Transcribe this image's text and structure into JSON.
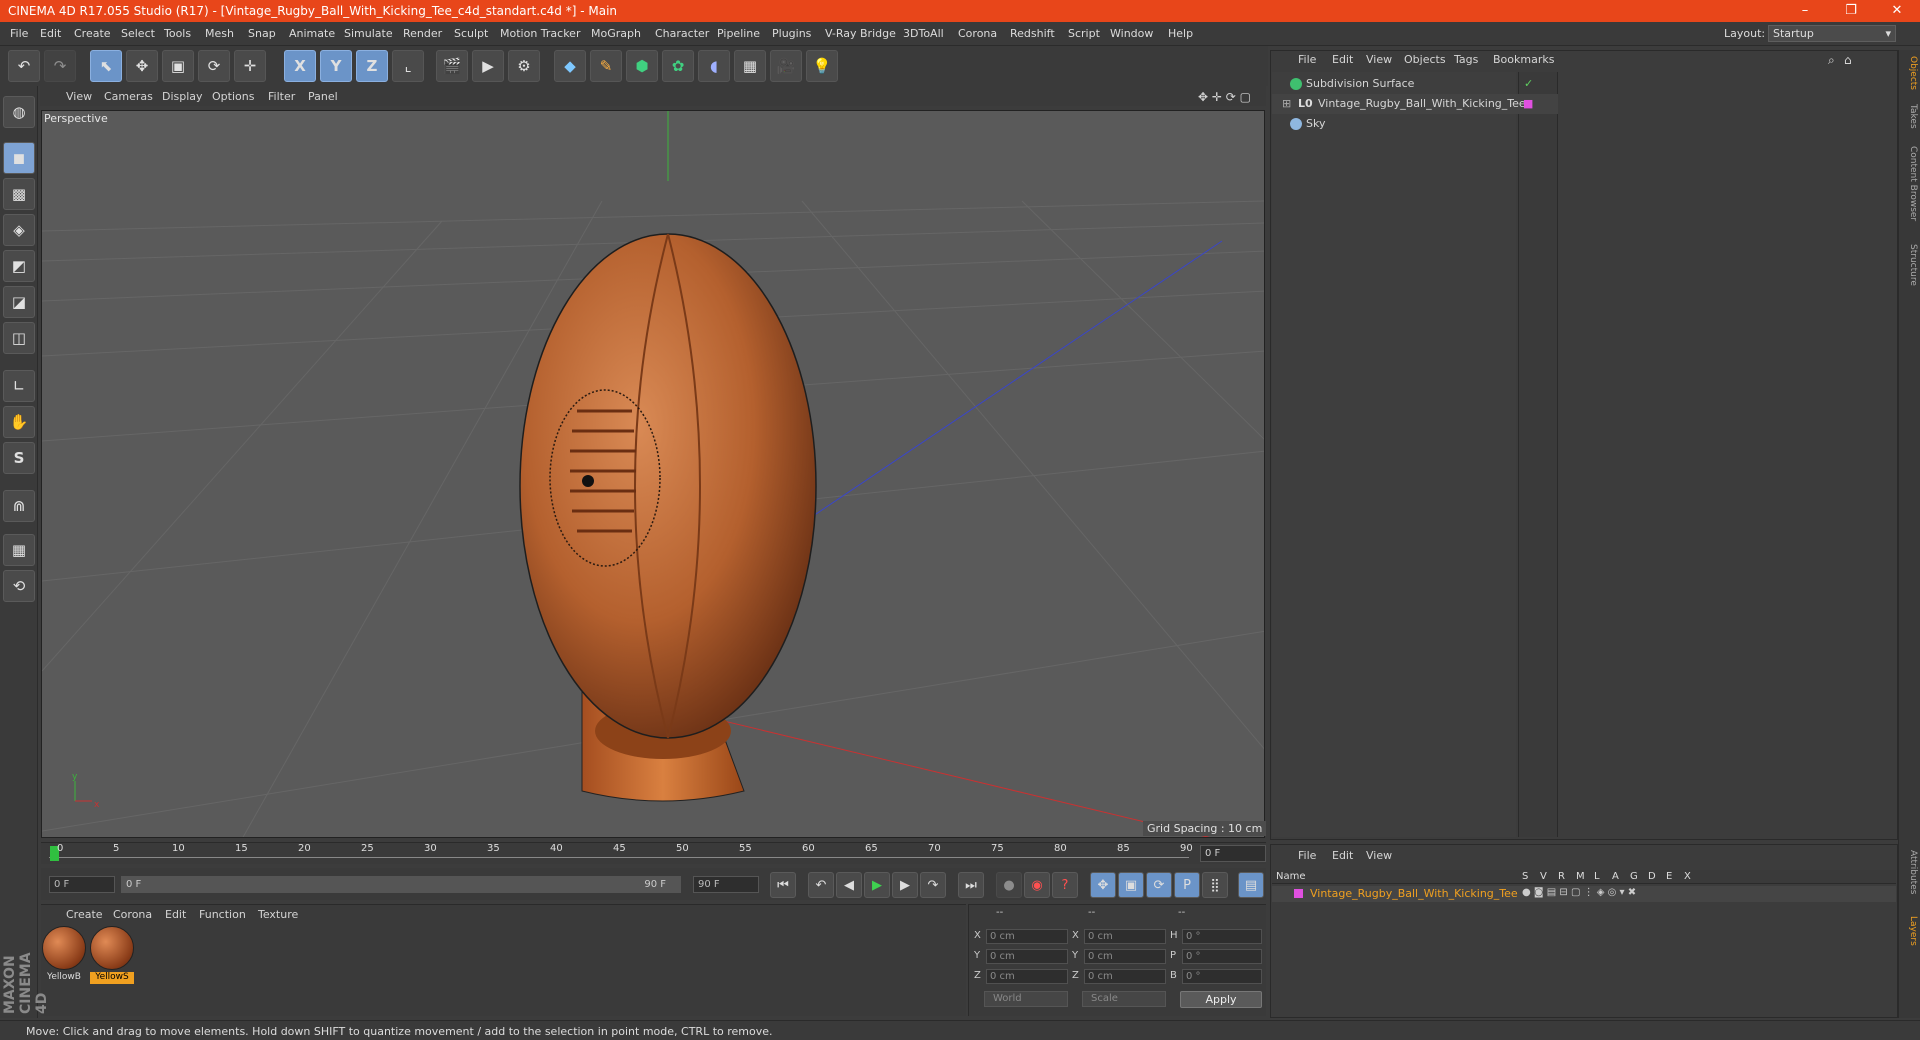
{
  "window": {
    "title": "CINEMA 4D R17.055 Studio (R17) - [Vintage_Rugby_Ball_With_Kicking_Tee_c4d_standart.c4d *] - Main",
    "minimize": "–",
    "restore": "❐",
    "close": "✕"
  },
  "menu": [
    "File",
    "Edit",
    "Create",
    "Select",
    "Tools",
    "Mesh",
    "Snap",
    "Animate",
    "Simulate",
    "Render",
    "Sculpt",
    "Motion Tracker",
    "MoGraph",
    "Character",
    "Pipeline",
    "Plugins",
    "V-Ray Bridge",
    "3DToAll",
    "Corona",
    "Redshift",
    "Script",
    "Window",
    "Help"
  ],
  "layout": {
    "label": "Layout:",
    "value": "Startup"
  },
  "toolbar": {
    "undo": "↶",
    "redo": "↷",
    "select": "⬉",
    "move": "✥",
    "scale": "▣",
    "rotate": "⟳",
    "live": "✛",
    "x": "X",
    "y": "Y",
    "z": "Z",
    "coord": "⌞",
    "render_view": "🎬",
    "render": "▶",
    "render_settings": "⚙",
    "cube": "◆",
    "pen": "✎",
    "subdiv": "⬢",
    "array": "✿",
    "deformer": "◖",
    "floor": "▦",
    "camera": "🎥",
    "light": "💡"
  },
  "left_tools": {
    "top": "◍",
    "model": "◼",
    "texture": "▩",
    "workplane": "◈",
    "point": "◩",
    "edge": "◪",
    "poly": "◫",
    "axis": "∟",
    "tweak": "✋",
    "snap": "S",
    "magnet": "⋒",
    "grid_lock": "▦",
    "grid_anim": "⟲"
  },
  "viewport": {
    "menu": [
      "View",
      "Cameras",
      "Display",
      "Options",
      "Filter",
      "Panel"
    ],
    "label": "Perspective",
    "grid_spacing": "Grid Spacing : 10 cm",
    "axis_y": "y",
    "axis_x": "x"
  },
  "timeline": {
    "ticks": [
      "0",
      "5",
      "10",
      "15",
      "20",
      "25",
      "30",
      "35",
      "40",
      "45",
      "50",
      "55",
      "60",
      "65",
      "70",
      "75",
      "80",
      "85",
      "90"
    ],
    "current": "0 F",
    "start": "0 F",
    "range_start": "0 F",
    "range_end": "90 F",
    "end": "90 F"
  },
  "transport": {
    "first": "⏮",
    "prev_key": "↶",
    "prev": "◀",
    "play": "▶",
    "next": "▶",
    "next_key": "↷",
    "last": "⏭",
    "autokey": "●",
    "rec": "◉",
    "help": "?",
    "move": "✥",
    "scale": "▣",
    "rot": "⟳",
    "p": "P",
    "grid": "⣿",
    "film": "▤"
  },
  "materials": {
    "menu": [
      "Create",
      "Corona",
      "Edit",
      "Function",
      "Texture"
    ],
    "items": [
      {
        "name": "YellowB",
        "selected": false
      },
      {
        "name": "YellowS",
        "selected": true
      }
    ]
  },
  "coords": {
    "headers": [
      "--",
      "--",
      "--"
    ],
    "rows": [
      {
        "a": "X",
        "av": "0 cm",
        "b": "X",
        "bv": "0 cm",
        "c": "H",
        "cv": "0 °"
      },
      {
        "a": "Y",
        "av": "0 cm",
        "b": "Y",
        "bv": "0 cm",
        "c": "P",
        "cv": "0 °"
      },
      {
        "a": "Z",
        "av": "0 cm",
        "b": "Z",
        "bv": "0 cm",
        "c": "B",
        "cv": "0 °"
      }
    ],
    "world": "World",
    "scale": "Scale",
    "apply": "Apply"
  },
  "brand": "MAXON CINEMA 4D",
  "status": "Move: Click and drag to move elements. Hold down SHIFT to quantize movement / add to the selection in point mode, CTRL to remove.",
  "objects": {
    "menu": [
      "File",
      "Edit",
      "View",
      "Objects",
      "Tags",
      "Bookmarks"
    ],
    "items": [
      {
        "name": "Subdivision Surface",
        "icon": "subdiv-icon",
        "color": "#3fbf6f",
        "tag": "✓"
      },
      {
        "name": "Vintage_Rugby_Ball_With_Kicking_Tee",
        "icon": "null-icon",
        "color": "#d0d0d0",
        "tag": "■"
      },
      {
        "name": "Sky",
        "icon": "sky-icon",
        "color": "#8fb7e0",
        "tag": ""
      }
    ]
  },
  "right_tabs": [
    "Objects",
    "Takes",
    "Content Browser",
    "Structure",
    "Attributes",
    "Layers"
  ],
  "layers": {
    "menu": [
      "File",
      "Edit",
      "View"
    ],
    "headers": [
      "Name",
      "S",
      "V",
      "R",
      "M",
      "L",
      "A",
      "G",
      "D",
      "E",
      "X"
    ],
    "row": "Vintage_Rugby_Ball_With_Kicking_Tee",
    "row_color": "#e050e0"
  }
}
